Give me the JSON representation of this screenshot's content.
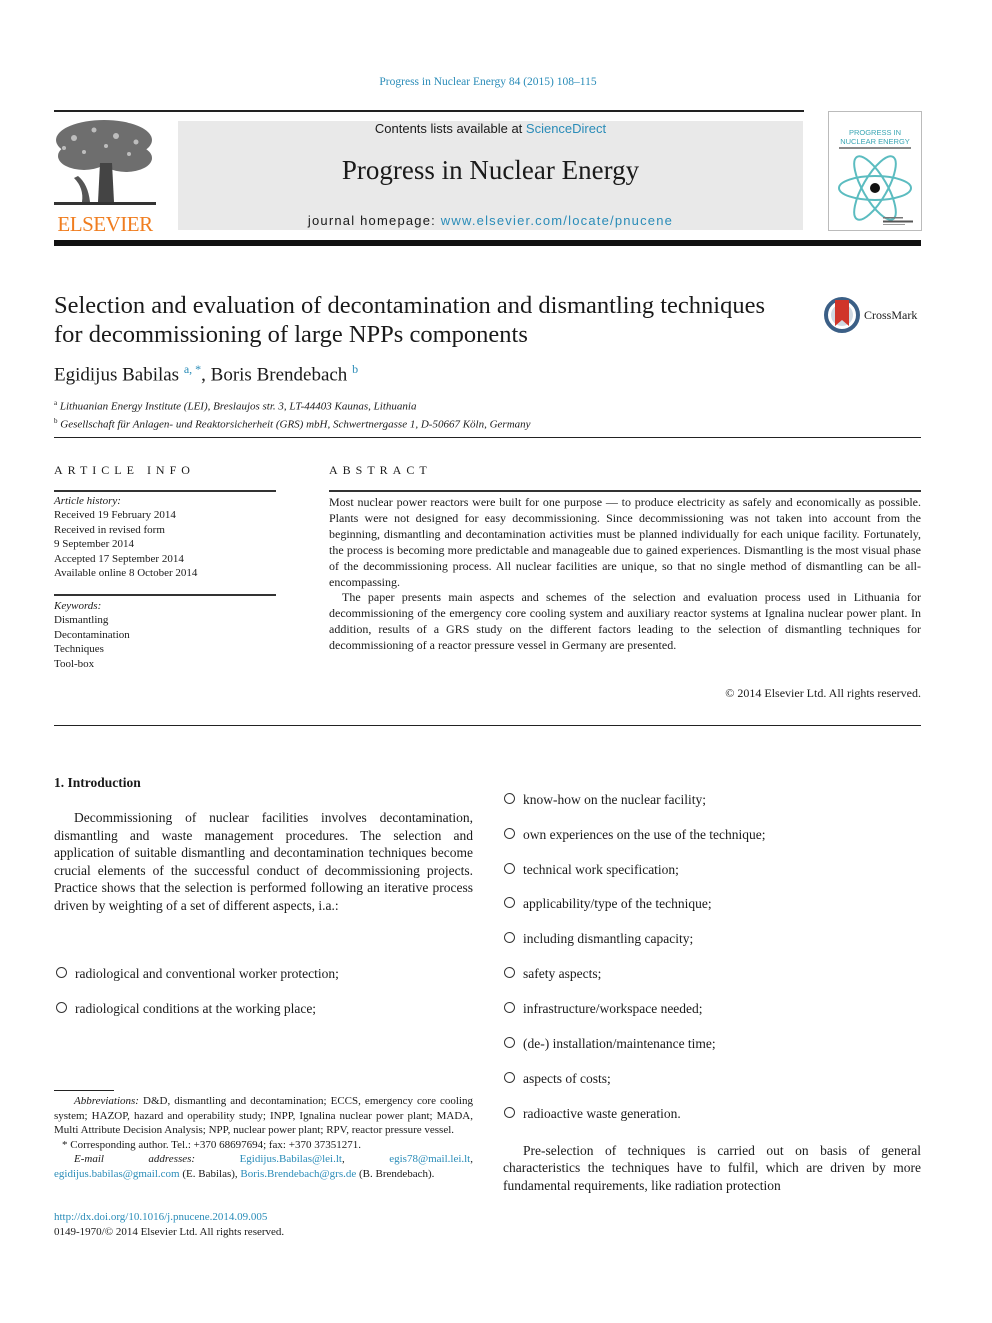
{
  "header": {
    "citation": "Progress in Nuclear Energy 84 (2015) 108–115",
    "contents_prefix": "Contents lists available at ",
    "contents_link": "ScienceDirect",
    "journal_title": "Progress in Nuclear Energy",
    "homepage_prefix": "journal homepage: ",
    "homepage_link": "www.elsevier.com/locate/pnucene",
    "publisher_logo_text": "ELSEVIER",
    "cover_title_line1": "PROGRESS IN",
    "cover_title_line2": "NUCLEAR ENERGY",
    "icons": {
      "publisher_logo": "elsevier-tree-logo",
      "cover": "journal-cover-atom-icon",
      "crossmark": "crossmark-icon"
    }
  },
  "colors": {
    "link": "#2a8cb8",
    "elsevier_orange": "#f07d1f",
    "banner_bg": "#e9e9e9",
    "cover_accent": "#5bbcc0",
    "crossmark_red": "#d0352a"
  },
  "article": {
    "title": "Selection and evaluation of decontamination and dismantling techniques for decommissioning of large NPPs components",
    "crossmark_label": "CrossMark",
    "authors": [
      {
        "name": "Egidijus Babilas",
        "sup": "a, *"
      },
      {
        "name": "Boris Brendebach",
        "sup": "b"
      }
    ],
    "author_separator": ", ",
    "affiliations": [
      {
        "mark": "a",
        "text": "Lithuanian Energy Institute (LEI), Breslaujos str. 3, LT-44403 Kaunas, Lithuania"
      },
      {
        "mark": "b",
        "text": "Gesellschaft für Anlagen- und Reaktorsicherheit (GRS) mbH, Schwertnergasse 1, D-50667 Köln, Germany"
      }
    ]
  },
  "article_info": {
    "heading": "ARTICLE INFO",
    "history_label": "Article history:",
    "history": [
      "Received 19 February 2014",
      "Received in revised form",
      "9 September 2014",
      "Accepted 17 September 2014",
      "Available online 8 October 2014"
    ],
    "keywords_label": "Keywords:",
    "keywords": [
      "Dismantling",
      "Decontamination",
      "Techniques",
      "Tool-box"
    ]
  },
  "abstract": {
    "heading": "ABSTRACT",
    "paragraphs": [
      "Most nuclear power reactors were built for one purpose — to produce electricity as safely and economically as possible. Plants were not designed for easy decommissioning. Since decommissioning was not taken into account from the beginning, dismantling and decontamination activities must be planned individually for each unique facility. Fortunately, the process is becoming more predictable and manageable due to gained experiences. Dismantling is the most visual phase of the decommissioning process. All nuclear facilities are unique, so that no single method of dismantling can be all-encompassing.",
      "The paper presents main aspects and schemes of the selection and evaluation process used in Lithuania for decommissioning of the emergency core cooling system and auxiliary reactor systems at Ignalina nuclear power plant. In addition, results of a GRS study on the different factors leading to the selection of dismantling techniques for decommissioning of a reactor pressure vessel in Germany are presented."
    ],
    "copyright": "© 2014 Elsevier Ltd. All rights reserved."
  },
  "introduction": {
    "heading": "1.  Introduction",
    "paragraph": "Decommissioning of nuclear facilities involves decontamination, dismantling and waste management procedures. The selection and application of suitable dismantling and decontamination techniques become crucial elements of the successful conduct of decommissioning projects. Practice shows that the selection is performed following an iterative process driven by weighting of a set of different aspects, i.a.:",
    "bullets_left": [
      "radiological and conventional worker protection;",
      "radiological conditions at the working place;"
    ],
    "bullets_right": [
      "know-how on the nuclear facility;",
      "own experiences on the use of the technique;",
      "technical work specification;",
      "applicability/type of the technique;",
      "including dismantling capacity;",
      "safety aspects;",
      "infrastructure/workspace needed;",
      "(de-) installation/maintenance time;",
      "aspects of costs;",
      "radioactive waste generation."
    ],
    "continuation": "Pre-selection of techniques is carried out on basis of general characteristics the techniques have to fulfil, which are driven by more fundamental requirements, like radiation protection"
  },
  "footnotes": {
    "abbreviations_label": "Abbreviations:",
    "abbreviations": "D&D, dismantling and decontamination; ECCS, emergency core cooling system; HAZOP, hazard and operability study; INPP, Ignalina nuclear power plant; MADA, Multi Attribute Decision Analysis; NPP, nuclear power plant; RPV, reactor pressure vessel.",
    "corresponding": "* Corresponding author. Tel.: +370 68697694; fax: +370 37351271.",
    "email_label": "E-mail addresses:",
    "emails": [
      {
        "address": "Egidijus.Babilas@lei.lt",
        "suffix": ", "
      },
      {
        "address": "egis78@mail.lei.lt",
        "suffix": ", "
      },
      {
        "address": "egidijus.babilas@gmail.com",
        "suffix": " (E. Babilas), "
      },
      {
        "address": "Boris.Brendebach@grs.de",
        "suffix": " (B. Brendebach)."
      }
    ],
    "doi": "http://dx.doi.org/10.1016/j.pnucene.2014.09.005",
    "issn": "0149-1970/© 2014 Elsevier Ltd. All rights reserved."
  }
}
